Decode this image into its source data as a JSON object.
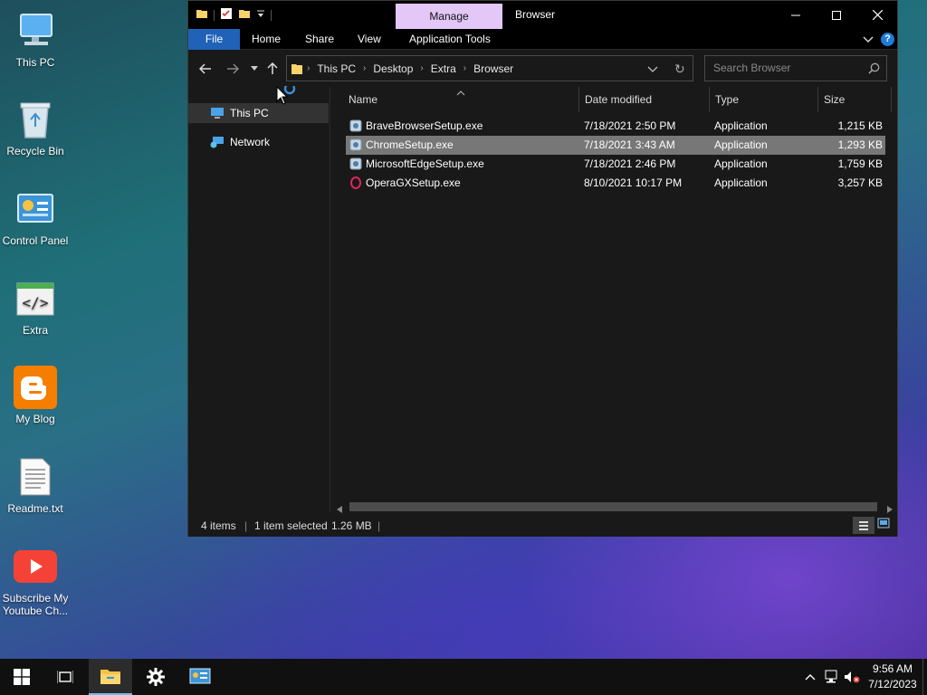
{
  "desktop": {
    "icons": [
      {
        "label": "This PC"
      },
      {
        "label": "Recycle Bin"
      },
      {
        "label": "Control Panel"
      },
      {
        "label": "Extra"
      },
      {
        "label": "My Blog"
      },
      {
        "label": "Readme.txt"
      },
      {
        "label": "Subscribe My Youtube Ch..."
      }
    ]
  },
  "window": {
    "title": "Browser",
    "manage_tab": "Manage",
    "ribbon_tabs": [
      "File",
      "Home",
      "Share",
      "View",
      "Application Tools"
    ],
    "breadcrumb": [
      "This PC",
      "Desktop",
      "Extra",
      "Browser"
    ],
    "search_placeholder": "Search Browser",
    "nav_pane": [
      {
        "label": "This PC",
        "selected": true
      },
      {
        "label": "Network",
        "selected": false
      }
    ],
    "columns": [
      "Name",
      "Date modified",
      "Type",
      "Size"
    ],
    "files": [
      {
        "name": "BraveBrowserSetup.exe",
        "date": "7/18/2021 2:50 PM",
        "type": "Application",
        "size": "1,215 KB",
        "icon": "installer-icon"
      },
      {
        "name": "ChromeSetup.exe",
        "date": "7/18/2021 3:43 AM",
        "type": "Application",
        "size": "1,293 KB",
        "icon": "installer-icon",
        "selected": true
      },
      {
        "name": "MicrosoftEdgeSetup.exe",
        "date": "7/18/2021 2:46 PM",
        "type": "Application",
        "size": "1,759 KB",
        "icon": "installer-icon"
      },
      {
        "name": "OperaGXSetup.exe",
        "date": "8/10/2021 10:17 PM",
        "type": "Application",
        "size": "3,257 KB",
        "icon": "opera-gx-icon"
      }
    ],
    "status": {
      "items": "4 items",
      "selected": "1 item selected",
      "size": "1.26 MB"
    }
  },
  "taskbar": {
    "time": "9:56 AM",
    "date": "7/12/2023"
  },
  "colors": {
    "accent": "#1f62b8",
    "manage_tab": "#e2c7f7",
    "window_bg": "#191919"
  }
}
